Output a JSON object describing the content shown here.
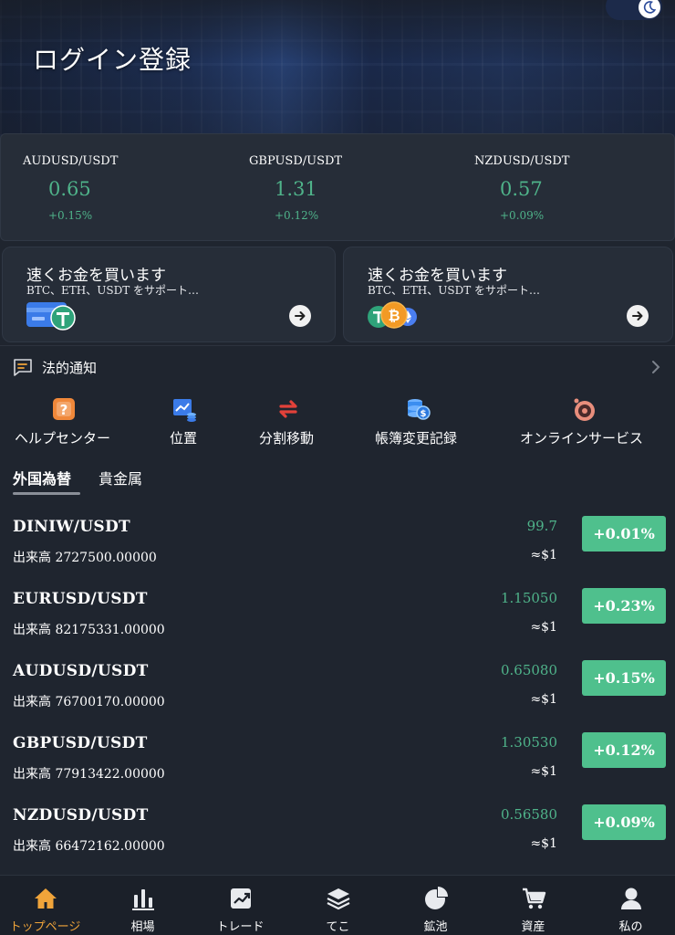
{
  "header": {
    "title": "ログイン登録"
  },
  "tickers": [
    {
      "pair": "AUDUSD/USDT",
      "price": "0.65",
      "change": "+0.15%"
    },
    {
      "pair": "GBPUSD/USDT",
      "price": "1.31",
      "change": "+0.12%"
    },
    {
      "pair": "NZDUSD/USDT",
      "price": "0.57",
      "change": "+0.09%"
    }
  ],
  "buy_cards": [
    {
      "title": "速くお金を買います",
      "subtitle": "BTC、ETH、USDT をサポート…"
    },
    {
      "title": "速くお金を買います",
      "subtitle": "BTC、ETH、USDT をサポート…"
    }
  ],
  "notice": {
    "label": "法的通知"
  },
  "quick_menu": [
    {
      "label": "ヘルプセンター",
      "icon": "help-icon"
    },
    {
      "label": "位置",
      "icon": "position-chart-icon"
    },
    {
      "label": "分割移動",
      "icon": "transfer-icon"
    },
    {
      "label": "帳簿変更記録",
      "icon": "coins-ledger-icon"
    },
    {
      "label": "オンラインサービス",
      "icon": "online-service-icon"
    }
  ],
  "tabs": [
    {
      "label": "外国為替",
      "active": true
    },
    {
      "label": "貴金属",
      "active": false
    }
  ],
  "market": {
    "rows": [
      {
        "symbol": "DINIW/USDT",
        "volume": "出来高 2727500.00000",
        "price": "99.7",
        "approx": "≈$1",
        "change": "+0.01%"
      },
      {
        "symbol": "EURUSD/USDT",
        "volume": "出来高 82175331.00000",
        "price": "1.15050",
        "approx": "≈$1",
        "change": "+0.23%"
      },
      {
        "symbol": "AUDUSD/USDT",
        "volume": "出来高 76700170.00000",
        "price": "0.65080",
        "approx": "≈$1",
        "change": "+0.15%"
      },
      {
        "symbol": "GBPUSD/USDT",
        "volume": "出来高 77913422.00000",
        "price": "1.30530",
        "approx": "≈$1",
        "change": "+0.12%"
      },
      {
        "symbol": "NZDUSD/USDT",
        "volume": "出来高 66472162.00000",
        "price": "0.56580",
        "approx": "≈$1",
        "change": "+0.09%"
      }
    ]
  },
  "bottom_nav": [
    {
      "label": "トップページ",
      "icon": "home-icon",
      "active": true
    },
    {
      "label": "相場",
      "icon": "market-bars-icon",
      "active": false
    },
    {
      "label": "トレード",
      "icon": "trade-chart-icon",
      "active": false
    },
    {
      "label": "てこ",
      "icon": "layers-icon",
      "active": false
    },
    {
      "label": "鉱池",
      "icon": "pie-icon",
      "active": false
    },
    {
      "label": "資産",
      "icon": "cart-icon",
      "active": false
    },
    {
      "label": "私の",
      "icon": "user-icon",
      "active": false
    }
  ],
  "colors": {
    "background": "#1f252f",
    "panel": "#262d38",
    "up_green": "#4fc08d",
    "price_green": "#4fb38a",
    "active_orange": "#f0a43a"
  }
}
